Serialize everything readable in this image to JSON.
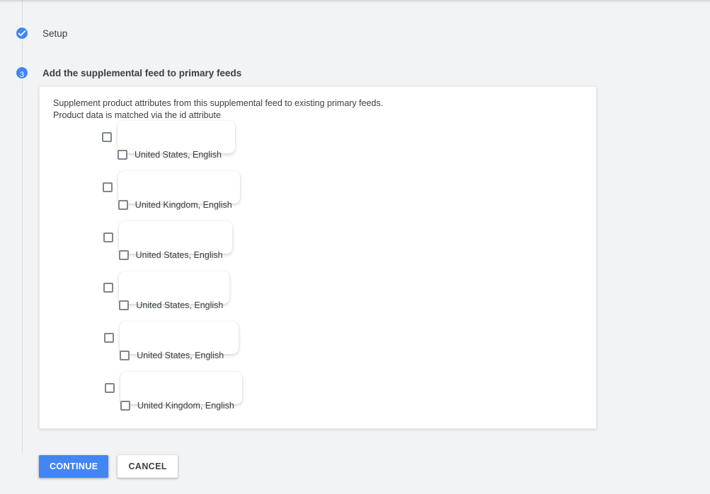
{
  "theme": {
    "accent_blue": "#4285F4",
    "page_background": "#F1F3F4",
    "card_background": "#FFFFFF",
    "text_primary": "#3C4043",
    "checkbox_border": "#80868B"
  },
  "stepper": {
    "steps": [
      {
        "id": "setup",
        "marker": "check-icon",
        "label": "Setup",
        "state": "completed"
      },
      {
        "id": "add-supplemental",
        "marker": "3",
        "label": "Add the supplemental feed to primary feeds",
        "state": "active"
      }
    ]
  },
  "card": {
    "description": "Supplement product attributes from this supplemental feed to existing primary feeds.\nProduct data is matched via the id attribute",
    "feeds": [
      {
        "placeholder_width": 166,
        "indent": 0,
        "locale": "United States, English"
      },
      {
        "placeholder_width": 172,
        "indent": 1,
        "locale": "United Kingdom, English"
      },
      {
        "placeholder_width": 160,
        "indent": 2,
        "locale": "United States, English"
      },
      {
        "placeholder_width": 156,
        "indent": 3,
        "locale": "United States, English"
      },
      {
        "placeholder_width": 168,
        "indent": 4,
        "locale": "United States, English"
      },
      {
        "placeholder_width": 172,
        "indent": 5,
        "locale": "United Kingdom, English"
      }
    ]
  },
  "actions": {
    "continue_label": "CONTINUE",
    "cancel_label": "CANCEL"
  }
}
